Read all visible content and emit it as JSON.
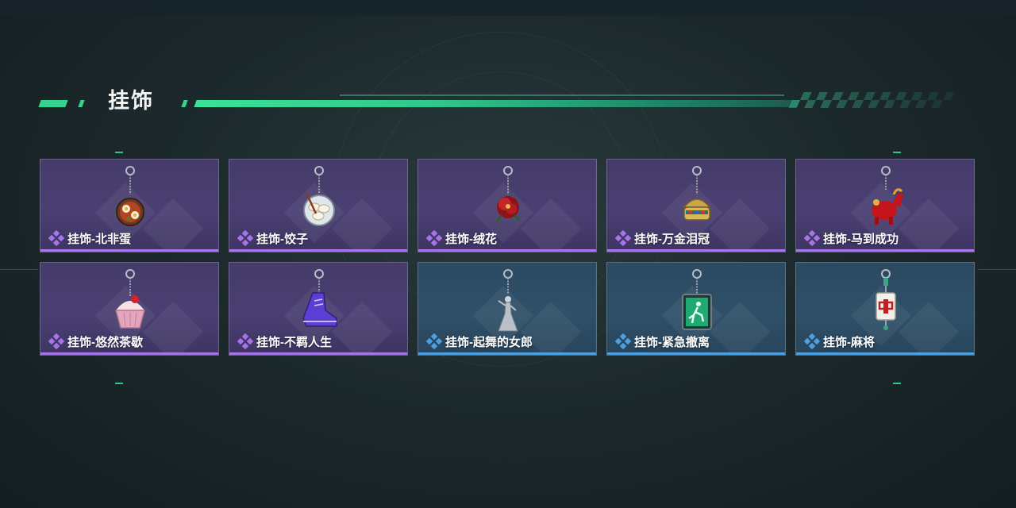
{
  "header": {
    "title": "挂饰"
  },
  "colors": {
    "accent": "#36d38f",
    "purple_rarity": "#a674e8",
    "blue_rarity": "#4e9fe0"
  },
  "items": [
    {
      "label": "挂饰-北非蛋",
      "rarity": "purple",
      "icon": "shakshuka-pan-charm-icon"
    },
    {
      "label": "挂饰-饺子",
      "rarity": "purple",
      "icon": "dumplings-plate-charm-icon"
    },
    {
      "label": "挂饰-绒花",
      "rarity": "purple",
      "icon": "velvet-flower-charm-icon"
    },
    {
      "label": "挂饰-万金泪冠",
      "rarity": "purple",
      "icon": "golden-crown-charm-icon"
    },
    {
      "label": "挂饰-马到成功",
      "rarity": "purple",
      "icon": "red-horse-charm-icon"
    },
    {
      "label": "挂饰-悠然茶歇",
      "rarity": "purple",
      "icon": "cupcake-charm-icon"
    },
    {
      "label": "挂饰-不羁人生",
      "rarity": "purple",
      "icon": "sneaker-charm-icon"
    },
    {
      "label": "挂饰-起舞的女郎",
      "rarity": "blue",
      "icon": "dancer-figurine-charm-icon"
    },
    {
      "label": "挂饰-紧急撤离",
      "rarity": "blue",
      "icon": "emergency-exit-sign-charm-icon"
    },
    {
      "label": "挂饰-麻将",
      "rarity": "blue",
      "icon": "mahjong-tile-charm-icon"
    }
  ]
}
